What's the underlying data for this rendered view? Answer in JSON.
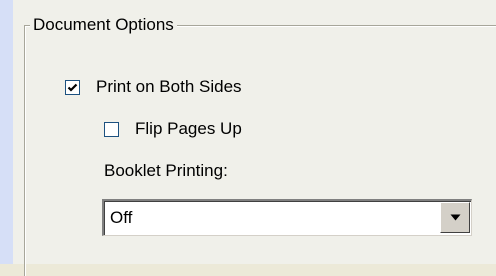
{
  "group": {
    "title": "Document Options"
  },
  "options": {
    "print_both_sides": {
      "label": "Print on Both Sides",
      "checked": true,
      "icon": "checkmark-icon"
    },
    "flip_pages_up": {
      "label": "Flip Pages Up",
      "checked": false
    }
  },
  "booklet": {
    "label": "Booklet Printing:",
    "selected": "Off",
    "arrow_icon": "dropdown-arrow-icon"
  }
}
